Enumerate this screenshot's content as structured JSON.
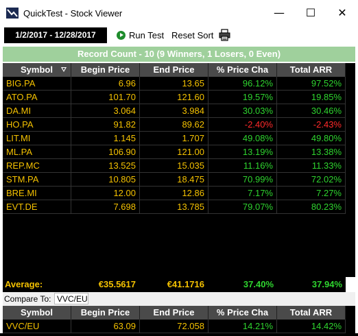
{
  "window": {
    "title": "QuickTest - Stock Viewer",
    "minimize": "—",
    "maximize": "☐",
    "close": "✕"
  },
  "toolbar": {
    "date_range": "1/2/2017 - 12/28/2017",
    "run_test": "Run Test",
    "reset_sort": "Reset Sort",
    "print_icon": "printer-icon"
  },
  "record_count": "Record Count - 10 (9 Winners, 1 Losers, 0 Even)",
  "columns": [
    "Symbol",
    "Begin Price",
    "End Price",
    "% Price Cha",
    "Total ARR"
  ],
  "rows": [
    {
      "symbol": "BIG.PA",
      "begin": "6.96",
      "end": "13.65",
      "pct": "96.12%",
      "arr": "97.52%",
      "pct_neg": false,
      "arr_neg": false
    },
    {
      "symbol": "ATO.PA",
      "begin": "101.70",
      "end": "121.60",
      "pct": "19.57%",
      "arr": "19.85%",
      "pct_neg": false,
      "arr_neg": false
    },
    {
      "symbol": "DA.MI",
      "begin": "3.064",
      "end": "3.984",
      "pct": "30.03%",
      "arr": "30.46%",
      "pct_neg": false,
      "arr_neg": false
    },
    {
      "symbol": "HO.PA",
      "begin": "91.82",
      "end": "89.62",
      "pct": "-2.40%",
      "arr": "-2.43%",
      "pct_neg": true,
      "arr_neg": true
    },
    {
      "symbol": "LIT.MI",
      "begin": "1.145",
      "end": "1.707",
      "pct": "49.08%",
      "arr": "49.80%",
      "pct_neg": false,
      "arr_neg": false
    },
    {
      "symbol": "ML.PA",
      "begin": "106.90",
      "end": "121.00",
      "pct": "13.19%",
      "arr": "13.38%",
      "pct_neg": false,
      "arr_neg": false
    },
    {
      "symbol": "REP.MC",
      "begin": "13.525",
      "end": "15.035",
      "pct": "11.16%",
      "arr": "11.33%",
      "pct_neg": false,
      "arr_neg": false
    },
    {
      "symbol": "STM.PA",
      "begin": "10.805",
      "end": "18.475",
      "pct": "70.99%",
      "arr": "72.02%",
      "pct_neg": false,
      "arr_neg": false
    },
    {
      "symbol": "BRE.MI",
      "begin": "12.00",
      "end": "12.86",
      "pct": "7.17%",
      "arr": "7.27%",
      "pct_neg": false,
      "arr_neg": false
    },
    {
      "symbol": "EVT.DE",
      "begin": "7.698",
      "end": "13.785",
      "pct": "79.07%",
      "arr": "80.23%",
      "pct_neg": false,
      "arr_neg": false
    }
  ],
  "average": {
    "label": "Average:",
    "begin": "€35.5617",
    "end": "€41.1716",
    "pct": "37.40%",
    "arr": "37.94%"
  },
  "compare": {
    "label": "Compare To:",
    "value": "VVC/EU"
  },
  "compare_row": {
    "symbol": "VVC/EU",
    "begin": "63.09",
    "end": "72.058",
    "pct": "14.21%",
    "arr": "14.42%"
  },
  "colors": {
    "accent_yellow": "#f5c200",
    "gain": "#2fd52f",
    "loss": "#ff2a2a",
    "record_bar": "#9fd09c"
  }
}
